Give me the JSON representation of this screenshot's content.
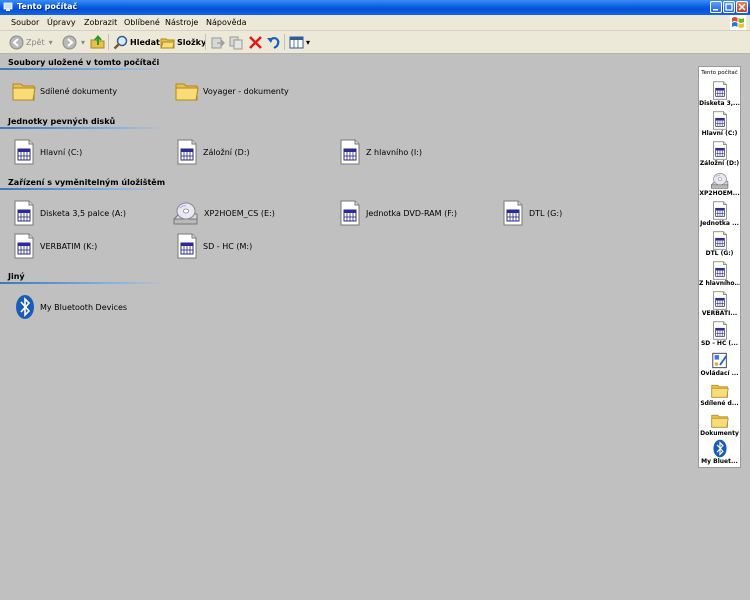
{
  "window": {
    "title": "Tento počítač"
  },
  "menu": [
    "Soubor",
    "Úpravy",
    "Zobrazit",
    "Oblíbené",
    "Nástroje",
    "Nápověda"
  ],
  "toolbar": {
    "back": "Zpět",
    "search": "Hledat",
    "folders": "Složky"
  },
  "groups": [
    {
      "title": "Soubory uložené v tomto počítači"
    },
    {
      "title": "Jednotky pevných disků"
    },
    {
      "title": "Zařízení s vyměnitelným úložištěm"
    },
    {
      "title": "Jiný"
    }
  ],
  "items": [
    {
      "label": "Sdílené dokumenty",
      "icon": "folder-icon"
    },
    {
      "label": "Voyager - dokumenty",
      "icon": "folder-icon"
    },
    {
      "label": "Hlavní (C:)",
      "icon": "drive-icon"
    },
    {
      "label": "Záložní (D:)",
      "icon": "drive-icon"
    },
    {
      "label": "Z hlavního (I:)",
      "icon": "drive-icon"
    },
    {
      "label": "Disketa 3,5 palce (A:)",
      "icon": "drive-icon"
    },
    {
      "label": "XP2HOEM_CS (E:)",
      "icon": "cd-drive-icon"
    },
    {
      "label": "Jednotka DVD-RAM (F:)",
      "icon": "drive-icon"
    },
    {
      "label": "DTL (G:)",
      "icon": "drive-icon"
    },
    {
      "label": "VERBATIM (K:)",
      "icon": "drive-icon"
    },
    {
      "label": "SD - HC (M:)",
      "icon": "drive-icon"
    },
    {
      "label": "My Bluetooth Devices",
      "icon": "bluetooth-icon"
    }
  ],
  "sidebar": {
    "title": "Tento počítač",
    "items": [
      {
        "label": "Disketa 3,...",
        "icon": "drive-icon"
      },
      {
        "label": "Hlavní (C:)",
        "icon": "drive-icon"
      },
      {
        "label": "Záložní (D:)",
        "icon": "drive-icon"
      },
      {
        "label": "XP2HOEM...",
        "icon": "cd-drive-icon"
      },
      {
        "label": "Jednotka ...",
        "icon": "drive-icon"
      },
      {
        "label": "DTL (G:)",
        "icon": "drive-icon"
      },
      {
        "label": "Z hlavního...",
        "icon": "drive-icon"
      },
      {
        "label": "VERBATI...",
        "icon": "drive-icon"
      },
      {
        "label": "SD - HC (...",
        "icon": "drive-icon"
      },
      {
        "label": "Ovládací ...",
        "icon": "control-panel-icon"
      },
      {
        "label": "Sdílené d...",
        "icon": "folder-icon"
      },
      {
        "label": "Dokumenty",
        "icon": "folder-icon"
      },
      {
        "label": "My Bluet...",
        "icon": "bluetooth-icon"
      }
    ]
  },
  "colors": {
    "titlebar": "#0a5fe0",
    "background": "#c0c0c0",
    "menubar": "#ece9d8",
    "group_line": "#3a78c0"
  }
}
